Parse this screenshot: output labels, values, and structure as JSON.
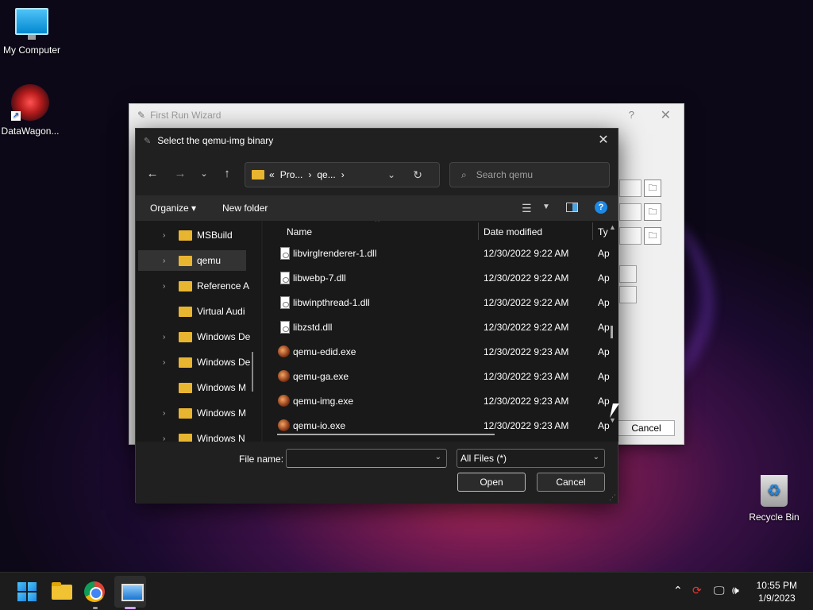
{
  "desktop": {
    "icons": [
      {
        "label": "My Computer",
        "icon": "monitor-icon"
      },
      {
        "label": "DataWagon...",
        "icon": "datawagon-icon"
      },
      {
        "label": "Recycle Bin",
        "icon": "recycle-bin-icon"
      }
    ]
  },
  "wizard": {
    "title": "First Run Wizard",
    "help": "?",
    "close": "✕",
    "cancel_label": "Cancel"
  },
  "dialog": {
    "title": "Select the qemu-img binary",
    "close": "✕",
    "breadcrumb": [
      "«",
      "Pro...",
      "›",
      "qe...",
      "›"
    ],
    "search_placeholder": "Search qemu",
    "toolbar": {
      "organize": "Organize ▾",
      "new_folder": "New folder"
    },
    "tree": [
      {
        "label": "MSBuild",
        "expandable": true,
        "selected": false
      },
      {
        "label": "qemu",
        "expandable": true,
        "selected": true
      },
      {
        "label": "Reference A",
        "expandable": true,
        "selected": false
      },
      {
        "label": "Virtual Audi",
        "expandable": false,
        "selected": false
      },
      {
        "label": "Windows De",
        "expandable": true,
        "selected": false
      },
      {
        "label": "Windows De",
        "expandable": true,
        "selected": false
      },
      {
        "label": "Windows M",
        "expandable": false,
        "selected": false
      },
      {
        "label": "Windows M",
        "expandable": true,
        "selected": false
      },
      {
        "label": "Windows N",
        "expandable": true,
        "selected": false
      }
    ],
    "columns": {
      "name": "Name",
      "date": "Date modified",
      "type": "Ty"
    },
    "files": [
      {
        "name": "libvirglrenderer-1.dll",
        "date": "12/30/2022 9:22 AM",
        "type": "Ap",
        "kind": "dll"
      },
      {
        "name": "libwebp-7.dll",
        "date": "12/30/2022 9:22 AM",
        "type": "Ap",
        "kind": "dll"
      },
      {
        "name": "libwinpthread-1.dll",
        "date": "12/30/2022 9:22 AM",
        "type": "Ap",
        "kind": "dll"
      },
      {
        "name": "libzstd.dll",
        "date": "12/30/2022 9:22 AM",
        "type": "Ap",
        "kind": "dll"
      },
      {
        "name": "qemu-edid.exe",
        "date": "12/30/2022 9:23 AM",
        "type": "Ap",
        "kind": "exe"
      },
      {
        "name": "qemu-ga.exe",
        "date": "12/30/2022 9:23 AM",
        "type": "Ap",
        "kind": "exe"
      },
      {
        "name": "qemu-img.exe",
        "date": "12/30/2022 9:23 AM",
        "type": "Ap",
        "kind": "exe"
      },
      {
        "name": "qemu-io.exe",
        "date": "12/30/2022 9:23 AM",
        "type": "Ap",
        "kind": "exe"
      }
    ],
    "file_name_label": "File name:",
    "file_name_value": "",
    "file_type": "All Files  (*)",
    "open_label": "Open",
    "cancel_label": "Cancel"
  },
  "taskbar": {
    "apps": [
      "start-icon",
      "file-explorer-icon",
      "chrome-icon",
      "qemu-manager-icon"
    ],
    "time": "10:55 PM",
    "date": "1/9/2023"
  }
}
